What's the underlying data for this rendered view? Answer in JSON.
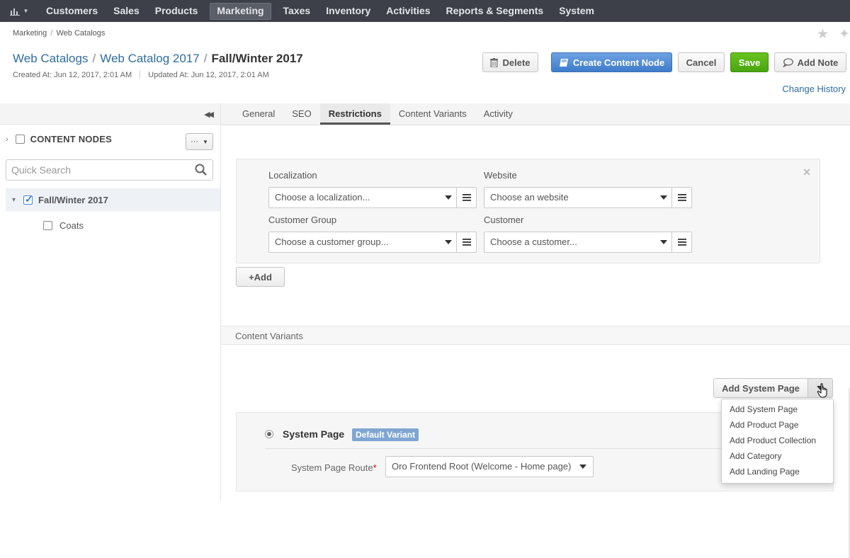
{
  "nav": {
    "items": [
      "Customers",
      "Sales",
      "Products",
      "Marketing",
      "Taxes",
      "Inventory",
      "Activities",
      "Reports & Segments",
      "System"
    ],
    "active": "Marketing"
  },
  "breadcrumb": {
    "part1": "Marketing",
    "separator": "/",
    "part2": "Web Catalogs"
  },
  "header": {
    "crumb1": "Web Catalogs",
    "crumb2": "Web Catalog 2017",
    "separator": "/",
    "title": "Fall/Winter 2017",
    "created": "Created At: Jun 12, 2017, 2:01 AM",
    "updated": "Updated At: Jun 12, 2017, 2:01 AM"
  },
  "actions": {
    "delete": "Delete",
    "create_node": "Create Content Node",
    "cancel": "Cancel",
    "save": "Save",
    "add_note": "Add Note",
    "change_history": "Change History"
  },
  "sidebar": {
    "nodes_label": "CONTENT NODES",
    "actions_label": "···",
    "search_placeholder": "Quick Search",
    "tree_root": "Fall/Winter 2017",
    "tree_child": "Coats"
  },
  "tabs": [
    "General",
    "SEO",
    "Restrictions",
    "Content Variants",
    "Activity"
  ],
  "active_tab": "Restrictions",
  "restriction": {
    "localization_label": "Localization",
    "localization_value": "Choose a localization...",
    "website_label": "Website",
    "website_value": "Choose an website",
    "customer_group_label": "Customer Group",
    "customer_group_value": "Choose a customer group...",
    "customer_label": "Customer",
    "customer_value": "Choose a customer..."
  },
  "add_button": "+Add",
  "content_variants": {
    "section_title": "Content Variants",
    "add_system_page": "Add System Page",
    "dropdown": [
      "Add System Page",
      "Add Product Page",
      "Add Product Collection",
      "Add Category",
      "Add Landing Page"
    ],
    "variant_title": "System Page",
    "default_badge": "Default Variant",
    "route_label": "System Page Route",
    "required_marker": "*",
    "route_value": "Oro Frontend Root (Welcome - Home page)"
  },
  "colors": {
    "nav_bg": "#3d4048",
    "link": "#2e6da4",
    "primary": "#3f7ccc",
    "success": "#4aa50f",
    "badge": "#7fa6d3"
  }
}
